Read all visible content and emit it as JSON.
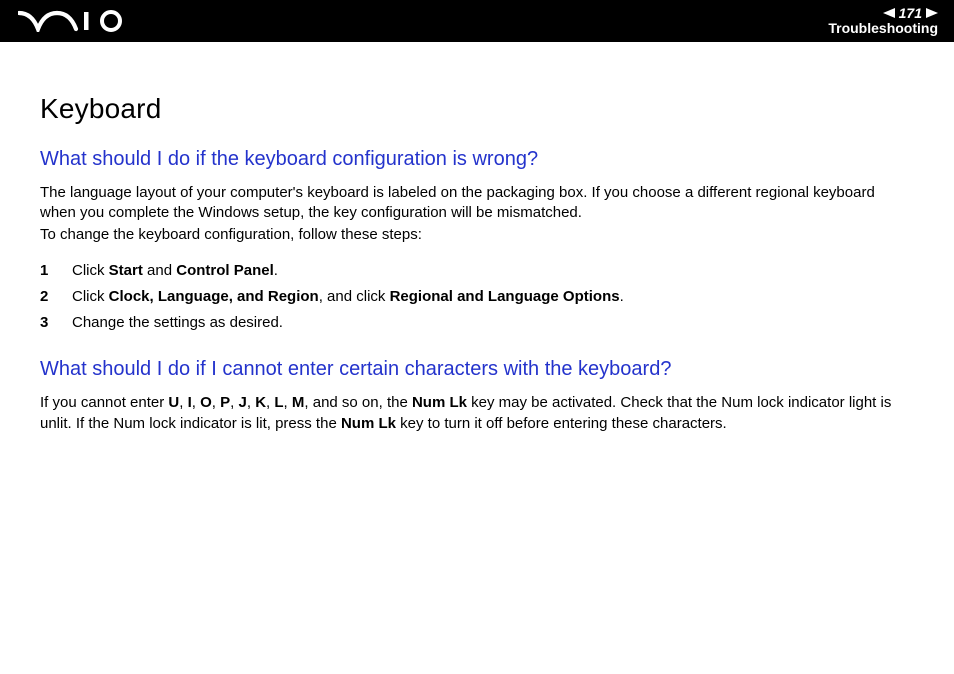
{
  "header": {
    "page_number": "171",
    "section": "Troubleshooting"
  },
  "body": {
    "title": "Keyboard",
    "q1": {
      "heading": "What should I do if the keyboard configuration is wrong?",
      "p1": "The language layout of your computer's keyboard is labeled on the packaging box. If you choose a different regional keyboard when you complete the Windows setup, the key configuration will be mismatched.",
      "p2": "To change the keyboard configuration, follow these steps:",
      "steps": {
        "s1": {
          "num": "1",
          "t1": "Click ",
          "b1": "Start",
          "t2": " and ",
          "b2": "Control Panel",
          "t3": "."
        },
        "s2": {
          "num": "2",
          "t1": "Click ",
          "b1": "Clock, Language, and Region",
          "t2": ", and click ",
          "b2": "Regional and Language Options",
          "t3": "."
        },
        "s3": {
          "num": "3",
          "t1": "Change the settings as desired."
        }
      }
    },
    "q2": {
      "heading": "What should I do if I cannot enter certain characters with the keyboard?",
      "p1a": "If you cannot enter ",
      "u": "U",
      "c1": ", ",
      "i": "I",
      "c2": ", ",
      "o": "O",
      "c3": ", ",
      "p": "P",
      "c4": ", ",
      "j": "J",
      "c5": ", ",
      "k": "K",
      "c6": ", ",
      "l": "L",
      "c7": ", ",
      "m": "M",
      "p1b": ", and so on, the ",
      "numlk1": "Num Lk",
      "p1c": " key may be activated. Check that the Num lock indicator light is unlit. If the Num lock indicator is lit, press the ",
      "numlk2": "Num Lk",
      "p1d": " key to turn it off before entering these characters."
    }
  }
}
